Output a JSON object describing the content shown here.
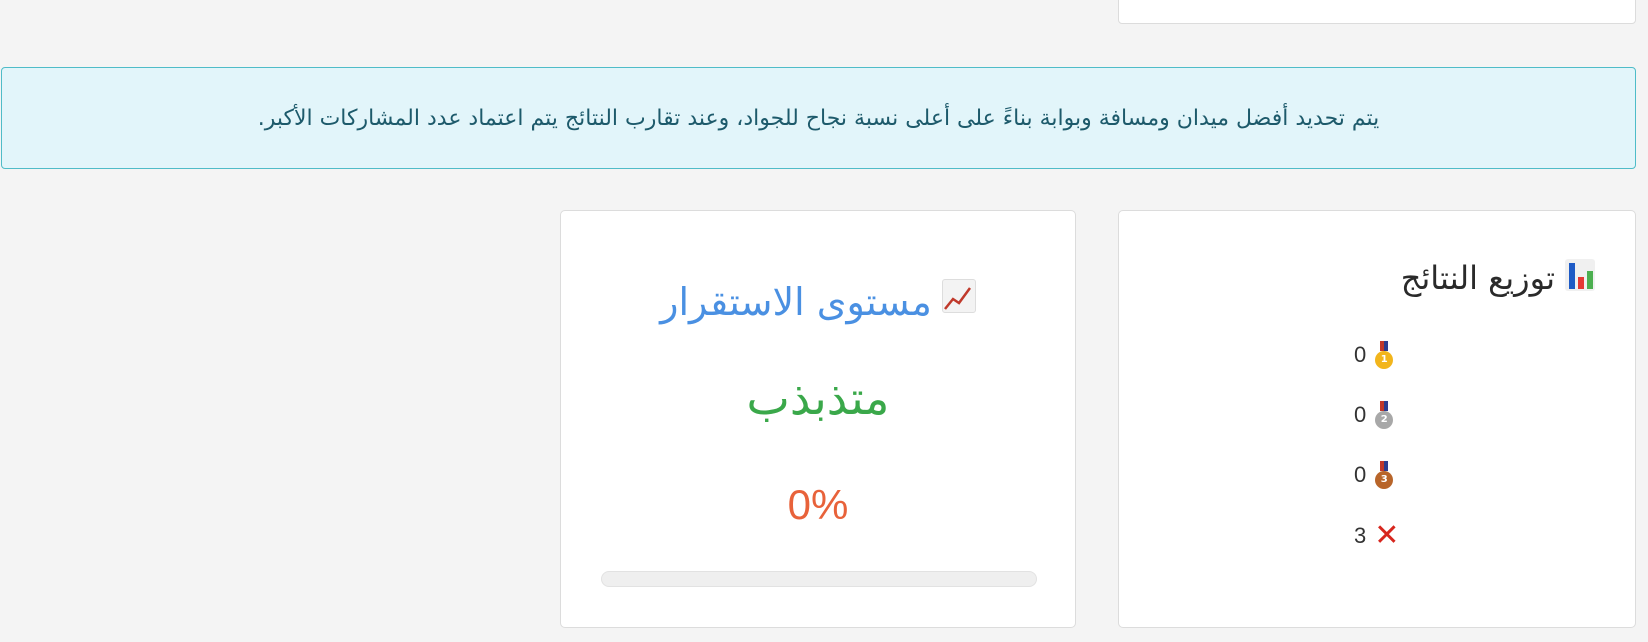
{
  "info_alert": {
    "text": "يتم تحديد أفضل ميدان ومسافة وبوابة بناءً على أعلى نسبة نجاح للجواد، وعند تقارب النتائج يتم اعتماد عدد المشاركات الأكبر."
  },
  "results_card": {
    "title": "توزيع النتائج",
    "icon": "bar-chart-icon",
    "rows": [
      {
        "icon": "gold-medal-icon",
        "count": "0"
      },
      {
        "icon": "silver-medal-icon",
        "count": "0"
      },
      {
        "icon": "bronze-medal-icon",
        "count": "0"
      },
      {
        "icon": "cross-mark-icon",
        "count": "3"
      }
    ]
  },
  "stability_card": {
    "title": "مستوى الاستقرار",
    "icon": "chart-increasing-icon",
    "status": "متذبذب",
    "percent_text": "0%",
    "progress": 0
  },
  "colors": {
    "alert_bg": "#e2f5fa",
    "alert_border": "#4fbcc8",
    "stab_title": "#4a90e2",
    "status_green": "#3aa84a",
    "percent_orange": "#e8623a"
  }
}
